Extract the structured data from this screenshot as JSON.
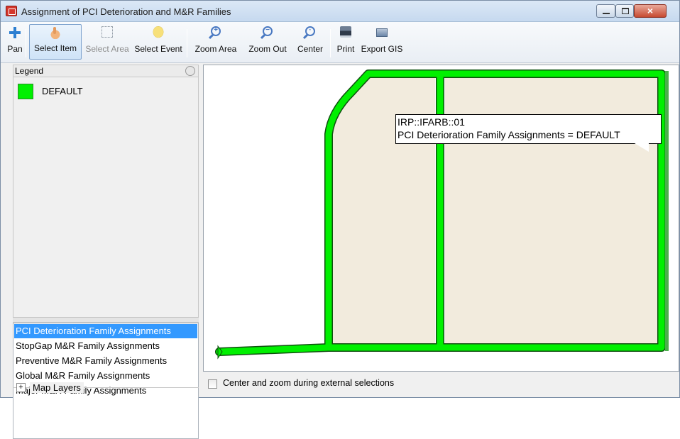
{
  "window": {
    "title": "Assignment of PCI Deterioration and M&R Families",
    "close_glyph": "×"
  },
  "toolbar": {
    "buttons": [
      {
        "label": "Pan",
        "icon": "pan-icon"
      },
      {
        "label": "Select Item",
        "icon": "hand-pointer-icon",
        "active": true
      },
      {
        "label": "Select Area",
        "icon": "select-area-icon",
        "disabled": true
      },
      {
        "label": "Select Event",
        "icon": "speech-bubble-icon"
      },
      {
        "label": "Zoom Area",
        "icon": "zoom-in-icon"
      },
      {
        "label": "Zoom Out",
        "icon": "zoom-out-icon"
      },
      {
        "label": "Center",
        "icon": "zoom-center-icon"
      },
      {
        "label": "Print",
        "icon": "printer-icon"
      },
      {
        "label": "Export GIS",
        "icon": "export-icon"
      }
    ],
    "zoom_in_glyph": "+",
    "zoom_out_glyph": "−",
    "center_glyph": "·"
  },
  "legend": {
    "header": "Legend",
    "items": [
      {
        "label": "DEFAULT",
        "color": "#00f000"
      }
    ]
  },
  "layers": {
    "items": [
      {
        "label": "PCI Deterioration Family Assignments",
        "selected": true
      },
      {
        "label": "StopGap M&R Family Assignments"
      },
      {
        "label": "Preventive M&R Family Assignments"
      },
      {
        "label": "Global M&R Family Assignments"
      },
      {
        "label": "Major M&R Family Assignments"
      }
    ]
  },
  "map_layers": {
    "expand_glyph": "+",
    "label": "Map Layers"
  },
  "map": {
    "road_color": "#00f000",
    "parcel_color": "#f2ebdd",
    "tooltip": {
      "line1": "IRP::IFARB::01",
      "line2": "PCI Deterioration Family Assignments = DEFAULT"
    }
  },
  "status": {
    "center_zoom_label": "Center and zoom during external selections",
    "center_zoom_checked": false
  }
}
